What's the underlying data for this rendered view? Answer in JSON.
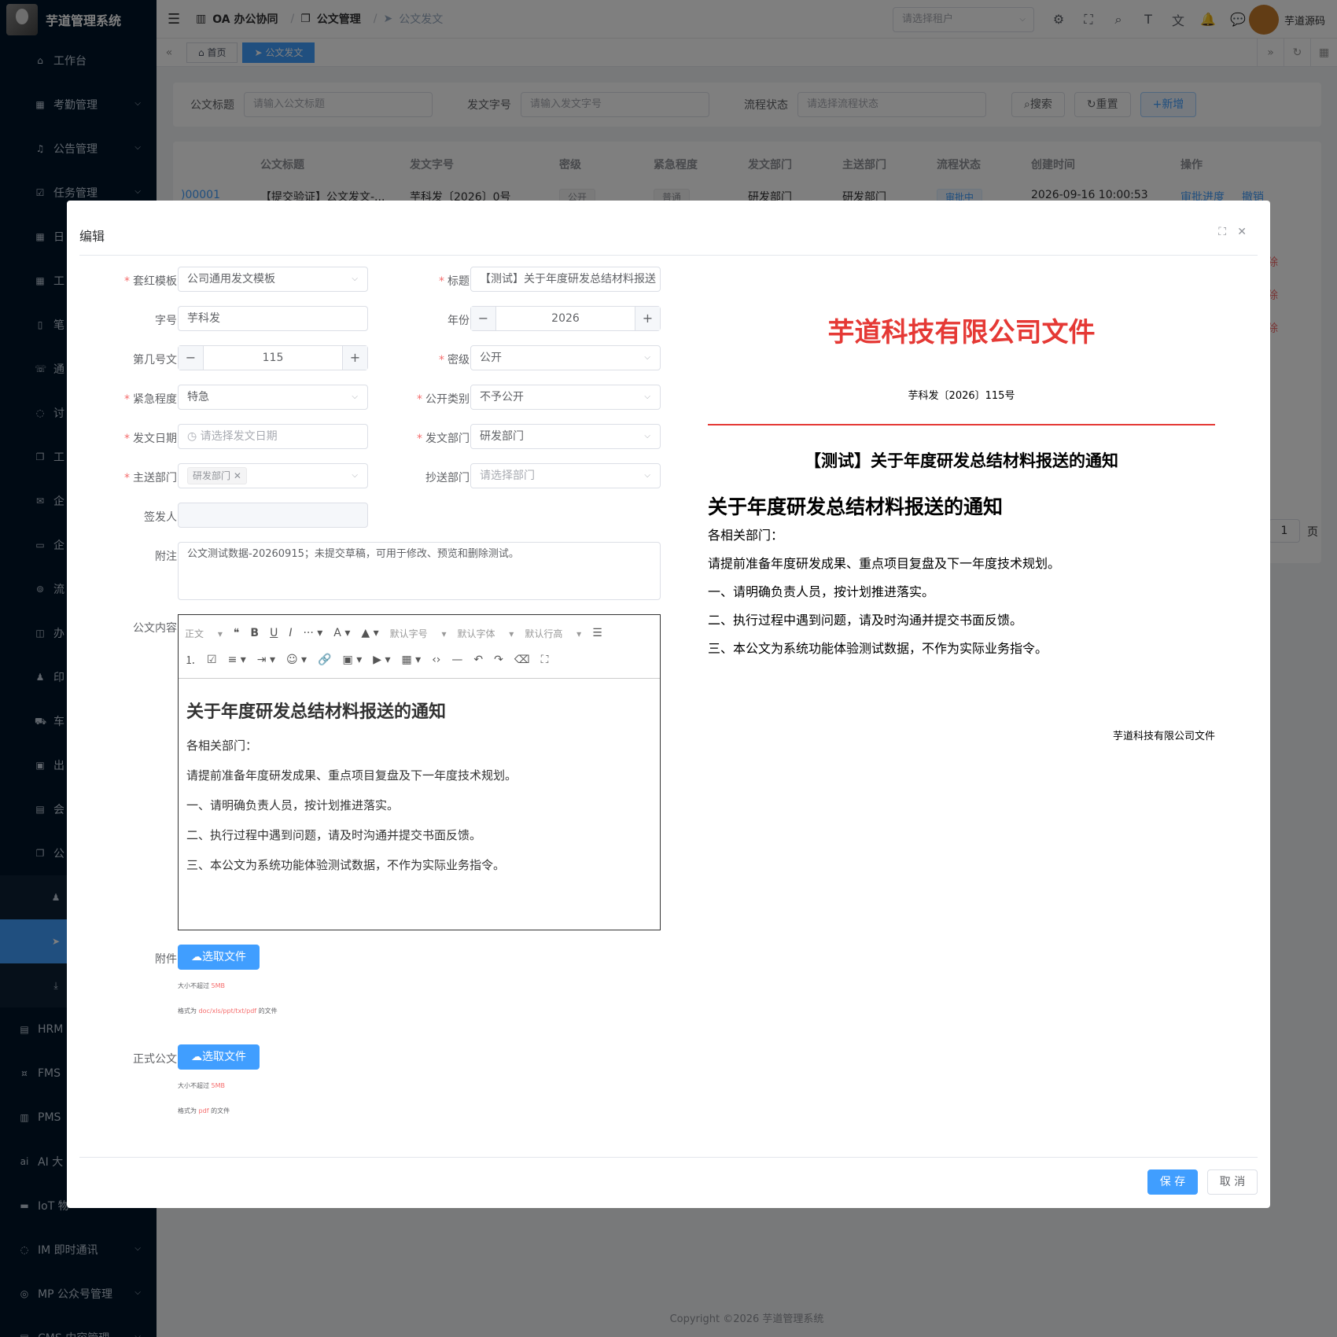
{
  "app": {
    "title": "芋道管理系统",
    "user": "芋道源码",
    "copyright": "Copyright ©2026 芋道管理系统"
  },
  "colors": {
    "primary": "#409eff",
    "sidebar": "#001529",
    "danger": "#f56c6c",
    "red_header": "#e53935"
  },
  "sidebar": {
    "items": [
      {
        "label": "工作台",
        "icon": "home-icon"
      },
      {
        "label": "考勤管理",
        "icon": "calendar-icon"
      },
      {
        "label": "公告管理",
        "icon": "bell-icon"
      },
      {
        "label": "任务管理",
        "icon": "task-icon"
      },
      {
        "label": "日",
        "icon": "calendar-icon"
      },
      {
        "label": "工",
        "icon": "calendar-icon"
      },
      {
        "label": "笔",
        "icon": "note-icon"
      },
      {
        "label": "通",
        "icon": "phone-icon"
      },
      {
        "label": "讨",
        "icon": "chat-icon"
      },
      {
        "label": "工",
        "icon": "copy-icon"
      },
      {
        "label": "企",
        "icon": "mail-icon"
      },
      {
        "label": "企",
        "icon": "folder-icon"
      },
      {
        "label": "流",
        "icon": "flow-icon"
      },
      {
        "label": "办",
        "icon": "bag-icon"
      },
      {
        "label": "印",
        "icon": "user-icon"
      },
      {
        "label": "车",
        "icon": "truck-icon"
      },
      {
        "label": "出",
        "icon": "briefcase-icon"
      },
      {
        "label": "会",
        "icon": "building-icon"
      },
      {
        "label": "公",
        "icon": "copy-icon"
      }
    ],
    "top_items": [
      {
        "label": "HRM",
        "icon": "building-icon"
      },
      {
        "label": "FMS",
        "icon": "money-icon"
      },
      {
        "label": "PMS",
        "icon": "chart-icon"
      },
      {
        "label": "AI 大",
        "icon": "ai-icon"
      },
      {
        "label": "IoT 物",
        "icon": "iot-icon"
      },
      {
        "label": "IM 即时通讯",
        "icon": "chat-icon"
      },
      {
        "label": "MP 公众号管理",
        "icon": "wechat-icon"
      },
      {
        "label": "CMS 内容管理",
        "icon": "doc-icon"
      }
    ]
  },
  "breadcrumb": {
    "root": "OA 办公协同",
    "mid": "公文管理",
    "current": "公文发文"
  },
  "header": {
    "tenant_placeholder": "请选择租户"
  },
  "tabs": [
    {
      "label": "首页"
    },
    {
      "label": "公文发文"
    }
  ],
  "search": {
    "title_label": "公文标题",
    "title_placeholder": "请输入公文标题",
    "code_label": "发文字号",
    "code_placeholder": "请输入发文字号",
    "status_label": "流程状态",
    "status_placeholder": "请选择流程状态",
    "btn_search": "搜索",
    "btn_reset": "重置",
    "btn_add": "新增"
  },
  "table": {
    "columns": [
      "公文标题",
      "发文字号",
      "密级",
      "紧急程度",
      "发文部门",
      "主送部门",
      "流程状态",
      "创建时间",
      "操作"
    ],
    "row": {
      "id": ")00001",
      "title": "【提交验证】公文发文-...",
      "code": "芋科发〔2026〕0号",
      "secret": "公开",
      "urgency": "普通",
      "dept": "研发部门",
      "main": "研发部门",
      "status": "审批中",
      "time": "2026-09-16 10:00:53",
      "op1": "审批进度",
      "op2": "撤销"
    },
    "side_ops": [
      "除",
      "除",
      "除"
    ],
    "pager_value": "1",
    "pager_unit": "页"
  },
  "dialog": {
    "title": "编辑",
    "fields": {
      "template_label": "套红模板",
      "template_value": "公司通用发文模板",
      "title_label": "标题",
      "title_value": "【测试】关于年度研发总结材料报送",
      "prefix_label": "字号",
      "prefix_value": "芋科发",
      "year_label": "年份",
      "year_value": "2026",
      "seq_label": "第几号文",
      "seq_value": "115",
      "secret_label": "密级",
      "secret_value": "公开",
      "urgency_label": "紧急程度",
      "urgency_value": "特急",
      "public_label": "公开类别",
      "public_value": "不予公开",
      "date_label": "发文日期",
      "date_placeholder": "请选择发文日期",
      "dept_label": "发文部门",
      "dept_value": "研发部门",
      "main_label": "主送部门",
      "main_chip": "研发部门",
      "cc_label": "抄送部门",
      "cc_placeholder": "请选择部门",
      "signer_label": "签发人",
      "remark_label": "附注",
      "remark_value": "公文测试数据-20260915；未提交草稿，可用于修改、预览和删除测试。",
      "content_label": "公文内容",
      "attach_label": "附件",
      "formal_label": "正式公文"
    },
    "toolbar": {
      "para": "正文",
      "size": "默认字号",
      "font": "默认字体",
      "line": "默认行高"
    },
    "content": {
      "heading": "关于年度研发总结材料报送的通知",
      "lines": [
        "各相关部门：",
        "请提前准备年度研发成果、重点项目复盘及下一年度技术规划。",
        "一、请明确负责人员，按计划推进落实。",
        "二、执行过程中遇到问题，请及时沟通并提交书面反馈。",
        "三、本公文为系统功能体验测试数据，不作为实际业务指令。"
      ]
    },
    "upload": {
      "btn": "选取文件",
      "size_pre": "大小不超过",
      "size_val": "5MB",
      "fmt_pre": "格式为",
      "attach_fmt": "doc/xls/ppt/txt/pdf",
      "formal_fmt": "pdf",
      "fmt_post": "的文件"
    },
    "preview": {
      "org": "芋道科技有限公司文件",
      "code": "芋科发〔2026〕115号",
      "title": "【测试】关于年度研发总结材料报送的通知",
      "sign": "芋道科技有限公司文件"
    },
    "save": "保 存",
    "cancel": "取 消"
  }
}
